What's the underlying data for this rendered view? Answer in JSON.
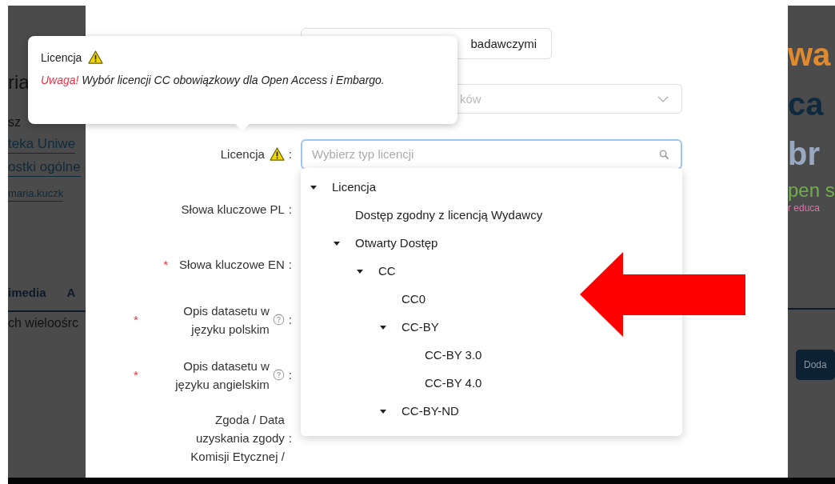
{
  "backdrop_left": {
    "texts": [
      {
        "kind": "heading",
        "text": "ria"
      },
      {
        "kind": "plain",
        "text": "sz"
      },
      {
        "kind": "link",
        "text": "teka Uniwe"
      },
      {
        "kind": "link",
        "text": "ostki ogólne"
      },
      {
        "kind": "small-link",
        "text": "maria.kuczk"
      },
      {
        "kind": "tabs",
        "text": "imedia",
        "extra": "A"
      },
      {
        "kind": "plain",
        "text": "ch wieloośrc"
      }
    ]
  },
  "backdrop_right": {
    "texts": [
      {
        "kind": "big",
        "text": "wa",
        "color": "#e08a30"
      },
      {
        "kind": "big",
        "text": "ca",
        "color": "#0f2a3e"
      },
      {
        "kind": "big",
        "text": "br",
        "color": "#98a8c0"
      },
      {
        "kind": "medium",
        "text": "pen s",
        "color": "#6fb04c"
      },
      {
        "kind": "small",
        "text": "r educa",
        "color": "#e070a8"
      }
    ],
    "button": "Doda"
  },
  "form": {
    "rows": [
      {
        "kind": "button",
        "value": "badawczymi"
      },
      {
        "kind": "select",
        "placeholder": "ków"
      },
      {
        "kind": "search",
        "label": "Licencja",
        "colon": ":",
        "warning": true,
        "help": false,
        "placeholder": "Wybierz typ licencji",
        "focused": true
      },
      {
        "kind": "label",
        "label": "Słowa kluczowe PL",
        "colon": ":",
        "warning": false,
        "help": false
      },
      {
        "kind": "label",
        "required_mark": "*",
        "label": "Słowa kluczowe EN",
        "colon": ":",
        "warning": false,
        "help": false
      },
      {
        "kind": "label",
        "required_mark": "*",
        "label": "Opis datasetu w języku polskim",
        "colon": ":",
        "warning": false,
        "help": true
      },
      {
        "kind": "label",
        "required_mark": "*",
        "label": "Opis datasetu w języku angielskim",
        "colon": ":",
        "warning": false,
        "help": true
      },
      {
        "kind": "label",
        "label": "Zgoda / Data uzyskania zgody Komisji Etycznej /",
        "colon": ":",
        "warning": false,
        "help": false
      }
    ]
  },
  "tooltip": {
    "title": "Licencja",
    "warning_prefix": "Uwaga!",
    "message": "Wybór licencji CC obowiązkowy dla Open Access i Embargo."
  },
  "tree": [
    {
      "label": "Licencja",
      "expanded": true,
      "children": [
        {
          "label": "Dostęp zgodny z licencją Wydawcy"
        },
        {
          "label": "Otwarty Dostęp",
          "expanded": true,
          "children": [
            {
              "label": "CC",
              "expanded": true,
              "children": [
                {
                  "label": "CC0"
                },
                {
                  "label": "CC-BY",
                  "expanded": true,
                  "children": [
                    {
                      "label": "CC-BY 3.0"
                    },
                    {
                      "label": "CC-BY 4.0"
                    }
                  ]
                },
                {
                  "label": "CC-BY-ND",
                  "expanded": true
                }
              ]
            }
          ]
        }
      ]
    }
  ]
}
